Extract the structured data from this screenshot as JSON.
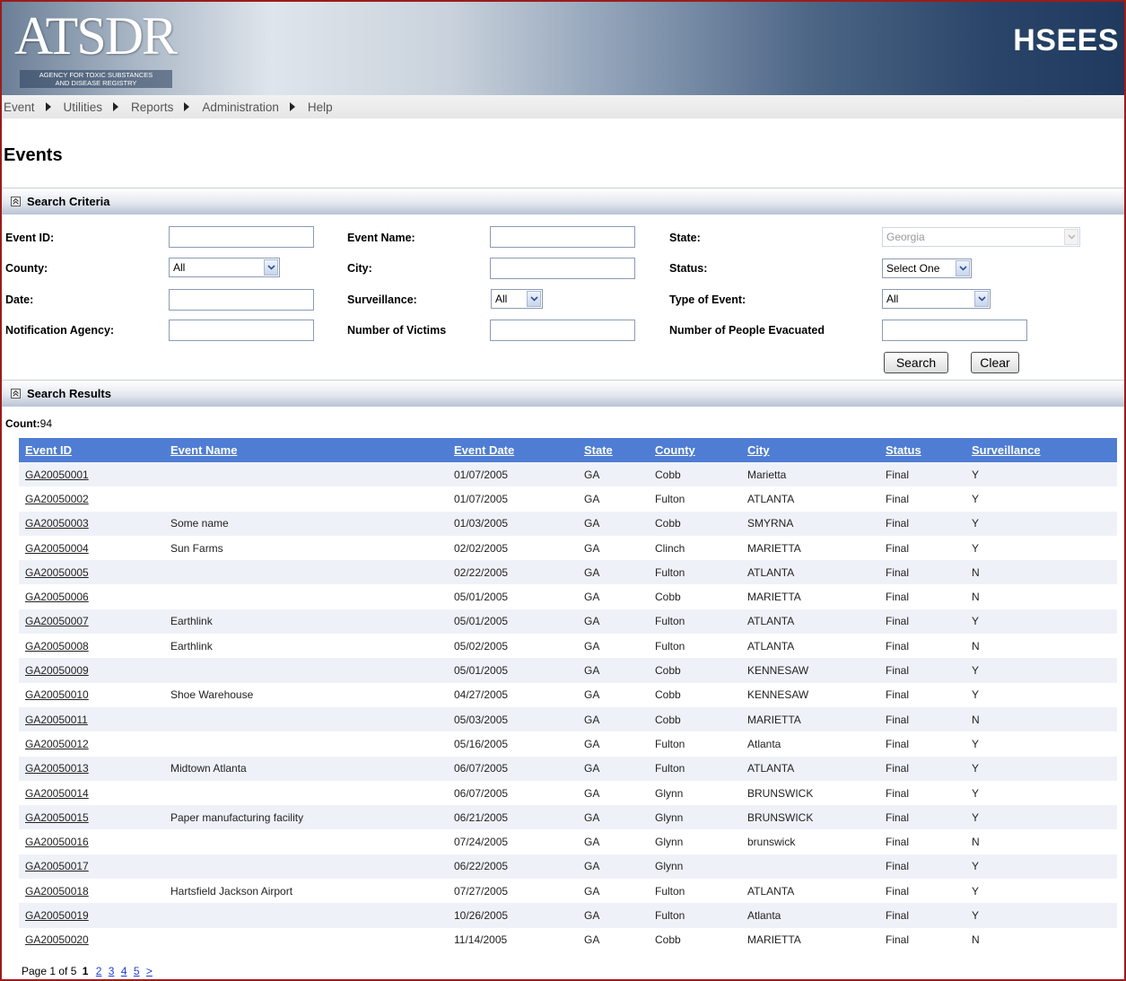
{
  "header": {
    "logo": "ATSDR",
    "logo_subtitle_line1": "AGENCY FOR TOXIC SUBSTANCES",
    "logo_subtitle_line2": "AND DISEASE REGISTRY",
    "app_name": "HSEES"
  },
  "nav": [
    "Event",
    "Utilities",
    "Reports",
    "Administration",
    "Help"
  ],
  "page_title": "Events",
  "criteria": {
    "section_title": "Search Criteria",
    "event_id_label": "Event ID:",
    "event_name_label": "Event Name:",
    "state_label": "State:",
    "state_value": "Georgia",
    "county_label": "County:",
    "county_value": "All",
    "city_label": "City:",
    "status_label": "Status:",
    "status_value": "Select One",
    "date_label": "Date:",
    "surveillance_label": "Surveillance:",
    "surveillance_value": "All",
    "type_label": "Type of Event:",
    "type_value": "All",
    "notification_label": "Notification Agency:",
    "victims_label": "Number of Victims",
    "evacuated_label": "Number of People Evacuated",
    "search_button": "Search",
    "clear_button": "Clear"
  },
  "results": {
    "section_title": "Search Results",
    "count_label": "Count:",
    "count_value": "94",
    "columns": [
      "Event ID",
      "Event Name",
      "Event Date",
      "State",
      "County",
      "City",
      "Status",
      "Surveillance"
    ],
    "rows": [
      [
        "GA20050001",
        "",
        "01/07/2005",
        "GA",
        "Cobb",
        "Marietta",
        "Final",
        "Y"
      ],
      [
        "GA20050002",
        "",
        "01/07/2005",
        "GA",
        "Fulton",
        "ATLANTA",
        "Final",
        "Y"
      ],
      [
        "GA20050003",
        "Some name",
        "01/03/2005",
        "GA",
        "Cobb",
        "SMYRNA",
        "Final",
        "Y"
      ],
      [
        "GA20050004",
        "Sun Farms",
        "02/02/2005",
        "GA",
        "Clinch",
        "MARIETTA",
        "Final",
        "Y"
      ],
      [
        "GA20050005",
        "",
        "02/22/2005",
        "GA",
        "Fulton",
        "ATLANTA",
        "Final",
        "N"
      ],
      [
        "GA20050006",
        "",
        "05/01/2005",
        "GA",
        "Cobb",
        "MARIETTA",
        "Final",
        "N"
      ],
      [
        "GA20050007",
        "Earthlink",
        "05/01/2005",
        "GA",
        "Fulton",
        "ATLANTA",
        "Final",
        "Y"
      ],
      [
        "GA20050008",
        "Earthlink",
        "05/02/2005",
        "GA",
        "Fulton",
        "ATLANTA",
        "Final",
        "N"
      ],
      [
        "GA20050009",
        "",
        "05/01/2005",
        "GA",
        "Cobb",
        "KENNESAW",
        "Final",
        "Y"
      ],
      [
        "GA20050010",
        "Shoe Warehouse",
        "04/27/2005",
        "GA",
        "Cobb",
        "KENNESAW",
        "Final",
        "Y"
      ],
      [
        "GA20050011",
        "",
        "05/03/2005",
        "GA",
        "Cobb",
        "MARIETTA",
        "Final",
        "N"
      ],
      [
        "GA20050012",
        "",
        "05/16/2005",
        "GA",
        "Fulton",
        "Atlanta",
        "Final",
        "Y"
      ],
      [
        "GA20050013",
        "Midtown Atlanta",
        "06/07/2005",
        "GA",
        "Fulton",
        "ATLANTA",
        "Final",
        "Y"
      ],
      [
        "GA20050014",
        "",
        "06/07/2005",
        "GA",
        "Glynn",
        "BRUNSWICK",
        "Final",
        "Y"
      ],
      [
        "GA20050015",
        "Paper manufacturing facility",
        "06/21/2005",
        "GA",
        "Glynn",
        "BRUNSWICK",
        "Final",
        "Y"
      ],
      [
        "GA20050016",
        "",
        "07/24/2005",
        "GA",
        "Glynn",
        "brunswick",
        "Final",
        "N"
      ],
      [
        "GA20050017",
        "",
        "06/22/2005",
        "GA",
        "Glynn",
        "",
        "Final",
        "Y"
      ],
      [
        "GA20050018",
        "Hartsfield Jackson Airport",
        "07/27/2005",
        "GA",
        "Fulton",
        "ATLANTA",
        "Final",
        "Y"
      ],
      [
        "GA20050019",
        "",
        "10/26/2005",
        "GA",
        "Fulton",
        "Atlanta",
        "Final",
        "Y"
      ],
      [
        "GA20050020",
        "",
        "11/14/2005",
        "GA",
        "Cobb",
        "MARIETTA",
        "Final",
        "N"
      ]
    ]
  },
  "pager": {
    "label": "Page 1 of 5",
    "current": "1",
    "pages": [
      "2",
      "3",
      "4",
      "5"
    ],
    "next": ">"
  },
  "colors": {
    "frame_border": "#9b1c1c",
    "table_header": "#4e7dd3",
    "row_alt": "#eef2f8"
  }
}
